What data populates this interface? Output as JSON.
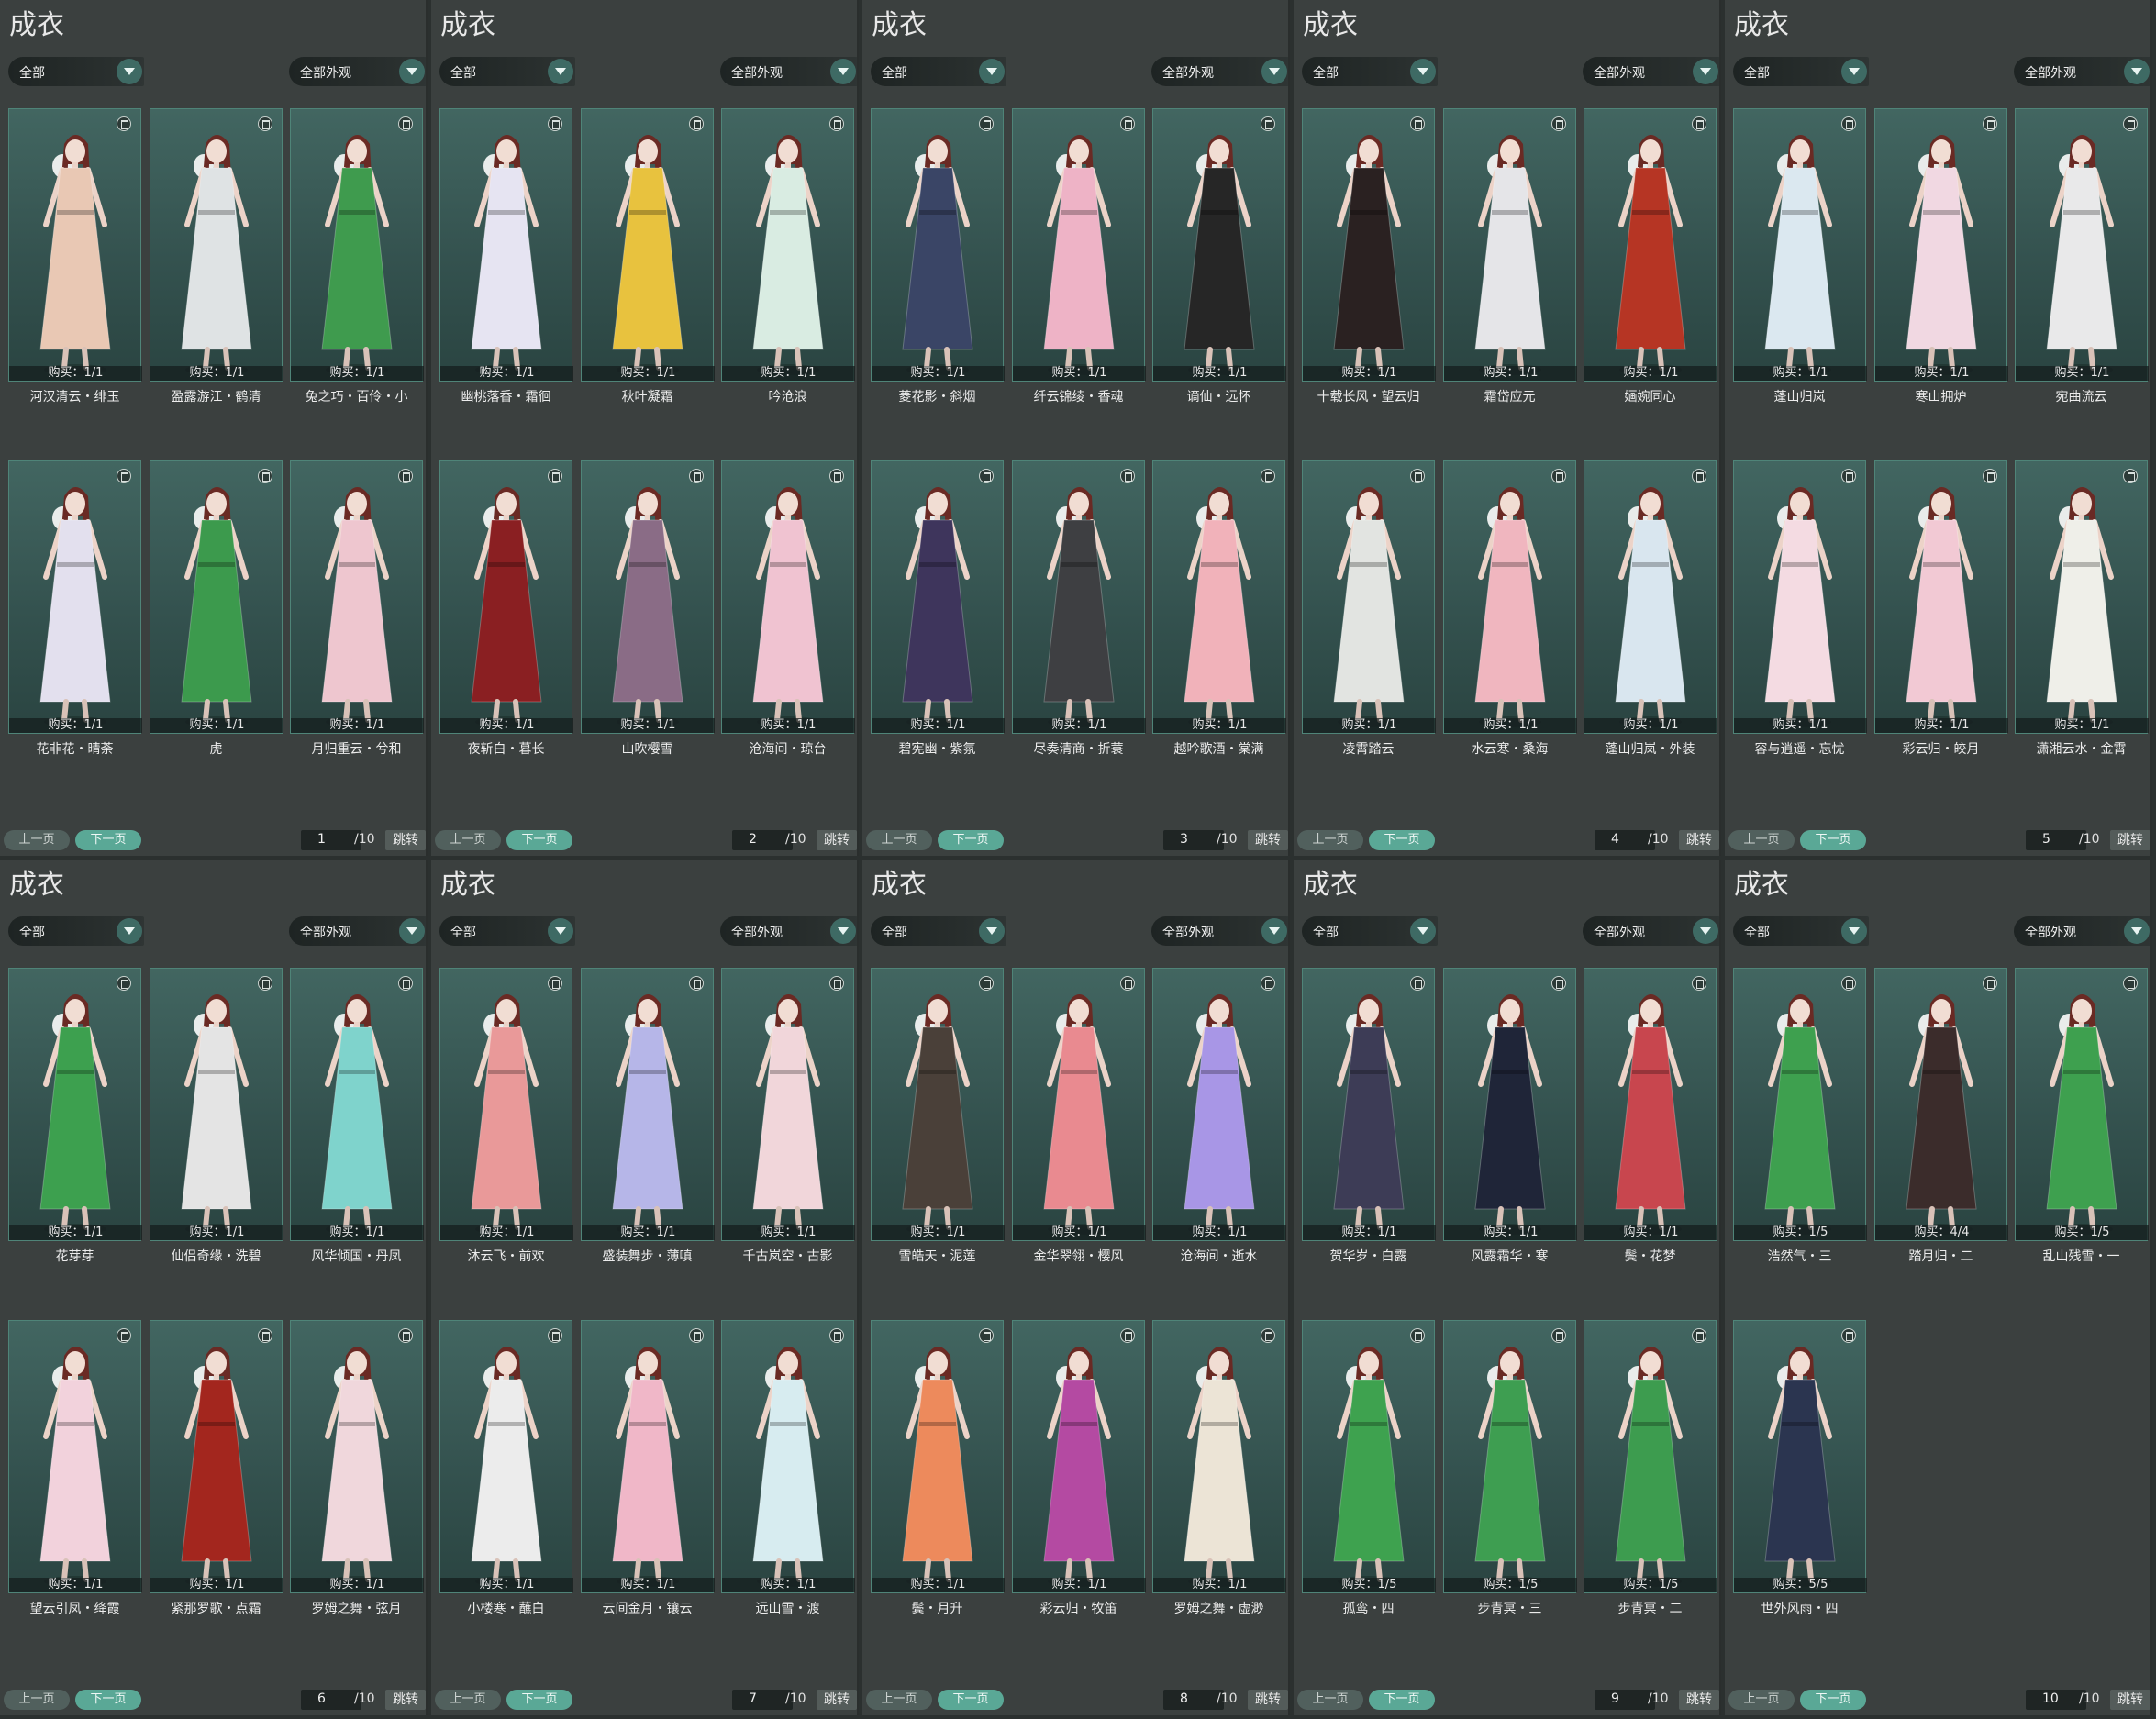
{
  "panels": [
    {
      "title": "成衣",
      "filter": "全部",
      "appearance": "全部外观",
      "prev": "上一页",
      "next": "下一页",
      "page": "1",
      "total": "/10",
      "jump": "跳转",
      "items": [
        {
          "name": "河汉清云・绯玉",
          "buy": "购买：1/1",
          "color": "#e9c8b4"
        },
        {
          "name": "盈露游江・鹤清",
          "buy": "购买：1/1",
          "color": "#dfe3e4"
        },
        {
          "name": "兔之巧・百伶・小",
          "buy": "购买：1/1",
          "color": "#3f9b4e"
        },
        {
          "name": "花非花・晴荼",
          "buy": "购买：1/1",
          "color": "#e3e0ee"
        },
        {
          "name": "虎",
          "buy": "购买：1/1",
          "color": "#3c9a4d"
        },
        {
          "name": "月归重云・兮和",
          "buy": "购买：1/1",
          "color": "#eec6cf"
        }
      ]
    },
    {
      "title": "成衣",
      "filter": "全部",
      "appearance": "全部外观",
      "prev": "上一页",
      "next": "下一页",
      "page": "2",
      "total": "/10",
      "jump": "跳转",
      "items": [
        {
          "name": "幽桃落香・霜徊",
          "buy": "购买：1/1",
          "color": "#e6e4f2"
        },
        {
          "name": "秋叶凝霜",
          "buy": "购买：1/1",
          "color": "#e8c23e"
        },
        {
          "name": "吟沧浪",
          "buy": "购买：1/1",
          "color": "#d9ece2"
        },
        {
          "name": "夜斩白・暮长",
          "buy": "购买：1/1",
          "color": "#8a1f22"
        },
        {
          "name": "山吹樱雪",
          "buy": "购买：1/1",
          "color": "#8a6c86"
        },
        {
          "name": "沧海间・琼台",
          "buy": "购买：1/1",
          "color": "#f0c3d1"
        }
      ]
    },
    {
      "title": "成衣",
      "filter": "全部",
      "appearance": "全部外观",
      "prev": "上一页",
      "next": "下一页",
      "page": "3",
      "total": "/10",
      "jump": "跳转",
      "items": [
        {
          "name": "菱花影・斜烟",
          "buy": "购买：1/1",
          "color": "#3a4566"
        },
        {
          "name": "纤云锦绫・香魂",
          "buy": "购买：1/1",
          "color": "#eeb3c6"
        },
        {
          "name": "谪仙・远怀",
          "buy": "购买：1/1",
          "color": "#262626"
        },
        {
          "name": "碧宪幽・紫氛",
          "buy": "购买：1/1",
          "color": "#3e355c"
        },
        {
          "name": "尽奏清商・折蓑",
          "buy": "购买：1/1",
          "color": "#3e3f42"
        },
        {
          "name": "越吟歌酒・棠满",
          "buy": "购买：1/1",
          "color": "#f1b2ba"
        }
      ]
    },
    {
      "title": "成衣",
      "filter": "全部",
      "appearance": "全部外观",
      "prev": "上一页",
      "next": "下一页",
      "page": "4",
      "total": "/10",
      "jump": "跳转",
      "items": [
        {
          "name": "十载长风・望云归",
          "buy": "购买：1/1",
          "color": "#2a2121"
        },
        {
          "name": "霜岱应元",
          "buy": "购买：1/1",
          "color": "#e5e5e8"
        },
        {
          "name": "婳婉同心",
          "buy": "购买：1/1",
          "color": "#b63524"
        },
        {
          "name": "凌霄踏云",
          "buy": "购买：1/1",
          "color": "#e2e4e1"
        },
        {
          "name": "水云寒・桑海",
          "buy": "购买：1/1",
          "color": "#f0b6bf"
        },
        {
          "name": "蓬山归岚・外装",
          "buy": "购买：1/1",
          "color": "#d9e6ef"
        }
      ]
    },
    {
      "title": "成衣",
      "filter": "全部",
      "appearance": "全部外观",
      "prev": "上一页",
      "next": "下一页",
      "page": "5",
      "total": "/10",
      "jump": "跳转",
      "items": [
        {
          "name": "蓬山归岚",
          "buy": "购买：1/1",
          "color": "#dbe8f0"
        },
        {
          "name": "寒山拥炉",
          "buy": "购买：1/1",
          "color": "#f1d8e2"
        },
        {
          "name": "宛曲流云",
          "buy": "购买：1/1",
          "color": "#e9e9ea"
        },
        {
          "name": "容与逍遥・忘忧",
          "buy": "购买：1/1",
          "color": "#f4dbe2"
        },
        {
          "name": "彩云归・皎月",
          "buy": "购买：1/1",
          "color": "#f2c9d4"
        },
        {
          "name": "潇湘云水・金霄",
          "buy": "购买：1/1",
          "color": "#efefe9"
        }
      ]
    },
    {
      "title": "成衣",
      "filter": "全部",
      "appearance": "全部外观",
      "prev": "上一页",
      "next": "下一页",
      "page": "6",
      "total": "/10",
      "jump": "跳转",
      "items": [
        {
          "name": "花芽芽",
          "buy": "购买：1/1",
          "color": "#3da04f"
        },
        {
          "name": "仙侣奇缘・洗碧",
          "buy": "购买：1/1",
          "color": "#e4e4e4"
        },
        {
          "name": "风华倾国・丹凤",
          "buy": "购买：1/1",
          "color": "#7fd3cc"
        },
        {
          "name": "望云引凤・绛霞",
          "buy": "购买：1/1",
          "color": "#f2d2dc"
        },
        {
          "name": "紧那罗歌・点霜",
          "buy": "购买：1/1",
          "color": "#a3261e"
        },
        {
          "name": "罗姆之舞・弦月",
          "buy": "购买：1/1",
          "color": "#f0d7dc"
        }
      ]
    },
    {
      "title": "成衣",
      "filter": "全部",
      "appearance": "全部外观",
      "prev": "上一页",
      "next": "下一页",
      "page": "7",
      "total": "/10",
      "jump": "跳转",
      "items": [
        {
          "name": "沐云飞・前欢",
          "buy": "购买：1/1",
          "color": "#e99999"
        },
        {
          "name": "盛装舞步・薄嗔",
          "buy": "购买：1/1",
          "color": "#b6b6e8"
        },
        {
          "name": "千古岚空・古影",
          "buy": "购买：1/1",
          "color": "#f1d6da"
        },
        {
          "name": "小楼寒・蘸白",
          "buy": "购买：1/1",
          "color": "#ececec"
        },
        {
          "name": "云间金月・镶云",
          "buy": "购买：1/1",
          "color": "#f0b7c8"
        },
        {
          "name": "远山雪・渡",
          "buy": "购买：1/1",
          "color": "#d7ecf0"
        }
      ]
    },
    {
      "title": "成衣",
      "filter": "全部",
      "appearance": "全部外观",
      "prev": "上一页",
      "next": "下一页",
      "page": "8",
      "total": "/10",
      "jump": "跳转",
      "items": [
        {
          "name": "雪皓天・泥莲",
          "buy": "购买：1/1",
          "color": "#4a4039"
        },
        {
          "name": "金华翠翎・樱风",
          "buy": "购买：1/1",
          "color": "#e98a90"
        },
        {
          "name": "沧海间・逝水",
          "buy": "购买：1/1",
          "color": "#a896e6"
        },
        {
          "name": "鬓・月升",
          "buy": "购买：1/1",
          "color": "#ed8a5c"
        },
        {
          "name": "彩云归・牧笛",
          "buy": "购买：1/1",
          "color": "#b44aa2"
        },
        {
          "name": "罗姆之舞・虚渺",
          "buy": "购买：1/1",
          "color": "#ece4d6"
        }
      ]
    },
    {
      "title": "成衣",
      "filter": "全部",
      "appearance": "全部外观",
      "prev": "上一页",
      "next": "下一页",
      "page": "9",
      "total": "/10",
      "jump": "跳转",
      "items": [
        {
          "name": "贺华岁・白露",
          "buy": "购买：1/1",
          "color": "#3d3c56"
        },
        {
          "name": "风露霜华・寒",
          "buy": "购买：1/1",
          "color": "#1f2538"
        },
        {
          "name": "鬓・花梦",
          "buy": "购买：1/1",
          "color": "#c8464e"
        },
        {
          "name": "孤鸾・四",
          "buy": "购买：1/5",
          "color": "#3ea24f"
        },
        {
          "name": "步青冥・三",
          "buy": "购买：1/5",
          "color": "#3e9e51"
        },
        {
          "name": "步青冥・二",
          "buy": "购买：1/5",
          "color": "#3d9c4f"
        }
      ]
    },
    {
      "title": "成衣",
      "filter": "全部",
      "appearance": "全部外观",
      "prev": "上一页",
      "next": "下一页",
      "page": "10",
      "total": "/10",
      "jump": "跳转",
      "items": [
        {
          "name": "浩然气・三",
          "buy": "购买：1/5",
          "color": "#3ea04f"
        },
        {
          "name": "踏月归・二",
          "buy": "购买：4/4",
          "color": "#3b2c2b"
        },
        {
          "name": "乱山残雪・一",
          "buy": "购买：1/5",
          "color": "#3ea04f"
        },
        {
          "name": "世外风雨・四",
          "buy": "购买：5/5",
          "color": "#2b3550"
        }
      ]
    }
  ]
}
